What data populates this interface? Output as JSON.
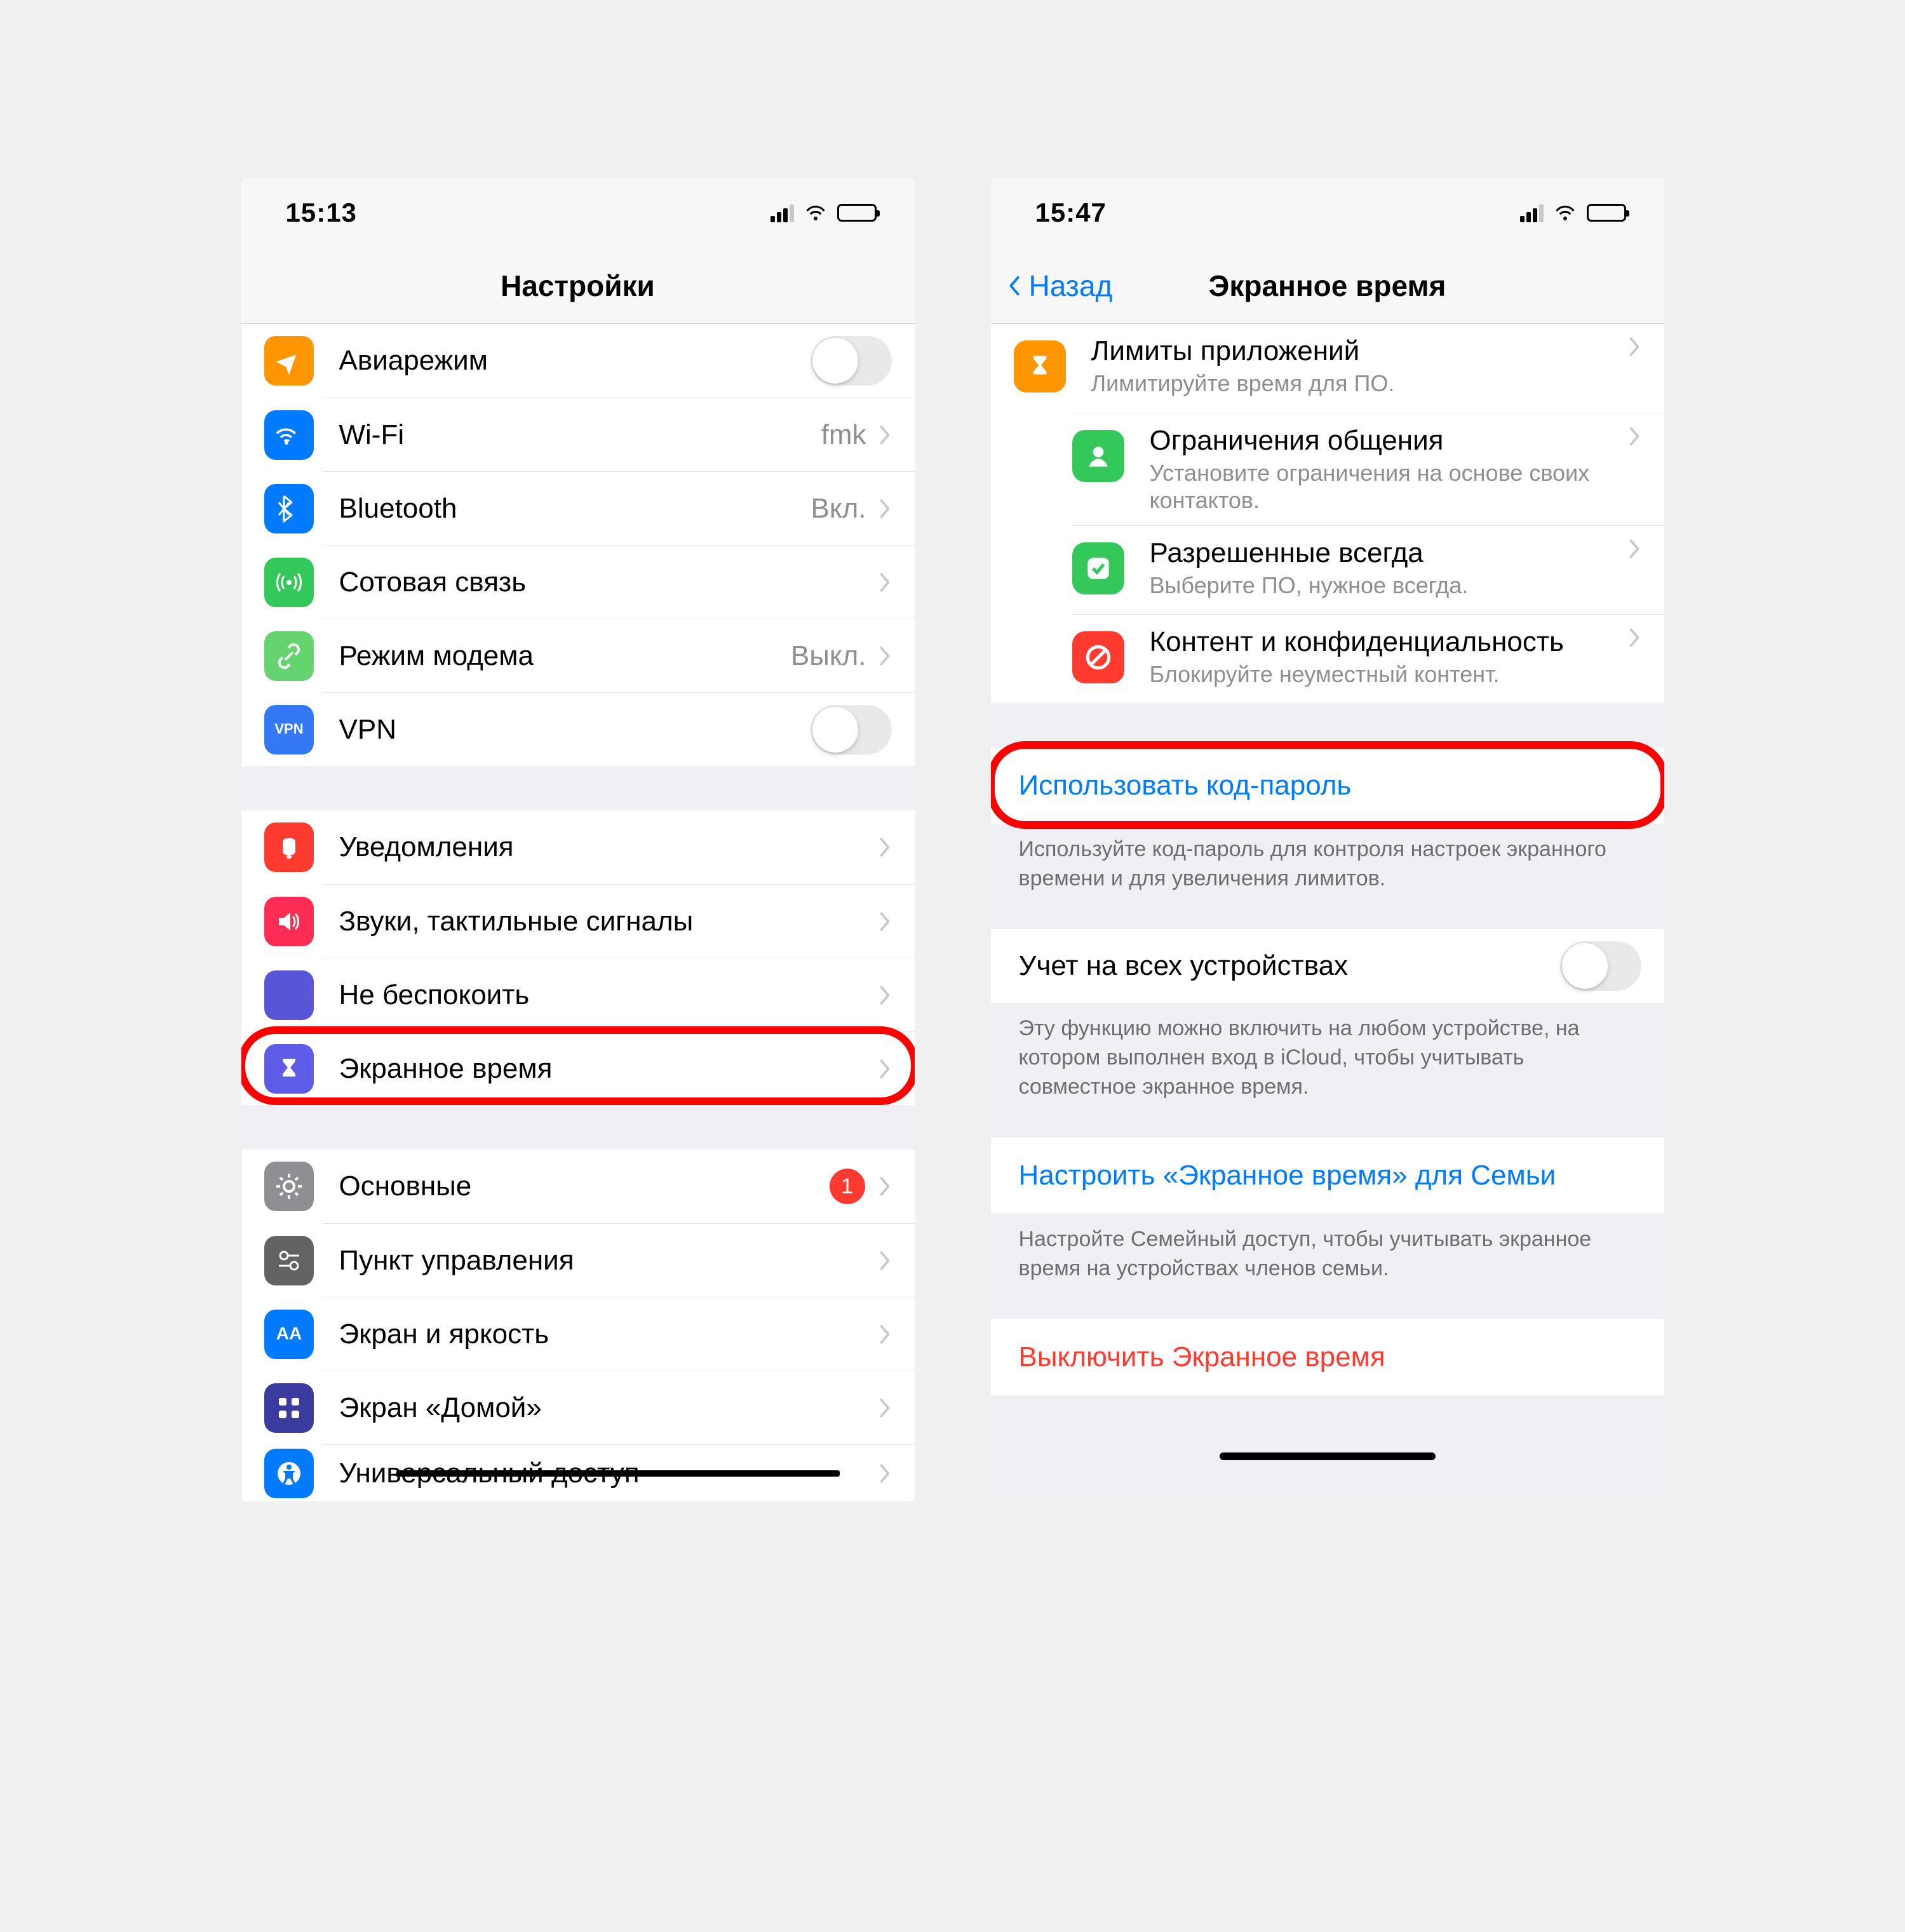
{
  "left": {
    "status": {
      "time": "15:13"
    },
    "title": "Настройки",
    "groups": [
      {
        "rows": [
          {
            "id": "airplane",
            "label": "Авиарежим",
            "type": "switch",
            "icon": "airplane-icon",
            "iconBg": "bg-orange"
          },
          {
            "id": "wifi",
            "label": "Wi-Fi",
            "value": "fmk",
            "type": "link",
            "icon": "wifi-icon",
            "iconBg": "bg-blue"
          },
          {
            "id": "bluetooth",
            "label": "Bluetooth",
            "value": "Вкл.",
            "type": "link",
            "icon": "bluetooth-icon",
            "iconBg": "bg-blue"
          },
          {
            "id": "cellular",
            "label": "Сотовая связь",
            "type": "link",
            "icon": "antenna-icon",
            "iconBg": "bg-green"
          },
          {
            "id": "hotspot",
            "label": "Режим модема",
            "value": "Выкл.",
            "type": "link",
            "icon": "link-icon",
            "iconBg": "bg-greenlink"
          },
          {
            "id": "vpn",
            "label": "VPN",
            "type": "switch",
            "icon": "vpn-icon",
            "iconBg": "bg-vpn"
          }
        ]
      },
      {
        "rows": [
          {
            "id": "notifications",
            "label": "Уведомления",
            "type": "link",
            "icon": "notifications-icon",
            "iconBg": "bg-red"
          },
          {
            "id": "sounds",
            "label": "Звуки, тактильные сигналы",
            "type": "link",
            "icon": "sounds-icon",
            "iconBg": "bg-pink"
          },
          {
            "id": "dnd",
            "label": "Не беспокоить",
            "type": "link",
            "icon": "moon-icon",
            "iconBg": "bg-purple"
          },
          {
            "id": "screentime",
            "label": "Экранное время",
            "type": "link",
            "icon": "hourglass-icon",
            "iconBg": "bg-purple2",
            "highlight": true
          }
        ]
      },
      {
        "rows": [
          {
            "id": "general",
            "label": "Основные",
            "type": "link",
            "icon": "gear-icon",
            "iconBg": "bg-gray",
            "badge": "1"
          },
          {
            "id": "control",
            "label": "Пункт управления",
            "type": "link",
            "icon": "switches-icon",
            "iconBg": "bg-gray2"
          },
          {
            "id": "display",
            "label": "Экран и яркость",
            "type": "link",
            "icon": "text-size-icon",
            "iconBg": "bg-blue"
          },
          {
            "id": "home",
            "label": "Экран «Домой»",
            "type": "link",
            "icon": "home-grid-icon",
            "iconBg": "bg-home"
          },
          {
            "id": "accessibility",
            "label": "Универсальный доступ",
            "type": "link",
            "icon": "accessibility-icon",
            "iconBg": "bg-access",
            "redact": true
          }
        ]
      }
    ]
  },
  "right": {
    "status": {
      "time": "15:47"
    },
    "back": "Назад",
    "title": "Экранное время",
    "topRows": [
      {
        "id": "app-limits",
        "label": "Лимиты приложений",
        "sub": "Лимитируйте время для ПО.",
        "icon": "hourglass-icon",
        "iconBg": "bg-hourglass"
      },
      {
        "id": "comm-limits",
        "label": "Ограничения общения",
        "sub": "Установите ограничения на основе своих контактов.",
        "icon": "contact-icon",
        "iconBg": "bg-contact"
      },
      {
        "id": "always-allowed",
        "label": "Разрешенные всегда",
        "sub": "Выберите ПО, нужное всегда.",
        "icon": "check-shield-icon",
        "iconBg": "bg-allow"
      },
      {
        "id": "content-privacy",
        "label": "Контент и конфиденциальность",
        "sub": "Блокируйте неуместный контент.",
        "icon": "no-sign-icon",
        "iconBg": "bg-content"
      }
    ],
    "passcodeRow": {
      "label": "Использовать код-пароль",
      "highlight": true
    },
    "passcodeFooter": "Используйте код-пароль для контроля настроек экранного времени и для увеличения лимитов.",
    "shareRow": {
      "label": "Учет на всех устройствах"
    },
    "shareFooter": "Эту функцию можно включить на любом устройстве, на котором выполнен вход в iCloud, чтобы учитывать совместное экранное время.",
    "familyRow": {
      "label": "Настроить «Экранное время» для Семьи"
    },
    "familyFooter": "Настройте Семейный доступ, чтобы учитывать экранное время на устройствах членов семьи.",
    "turnOffRow": {
      "label": "Выключить Экранное время"
    }
  }
}
